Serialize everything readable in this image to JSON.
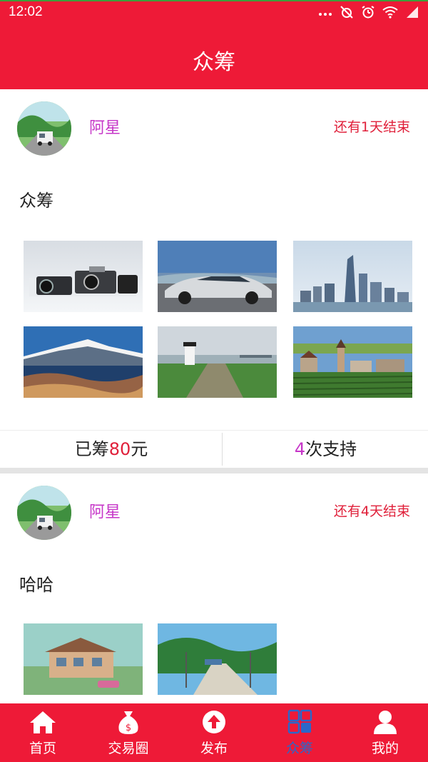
{
  "status_bar": {
    "time": "12:02",
    "icons": [
      "more-dots-icon",
      "alarm-off-icon",
      "alarm-clock-icon",
      "wifi-icon",
      "signal-icon"
    ]
  },
  "app_bar": {
    "title": "众筹"
  },
  "posts": [
    {
      "author": "阿星",
      "remaining": "还有1天结束",
      "content": "众筹",
      "images": [
        "cameras",
        "silver-car",
        "city-skyline",
        "snow-mountain-lake",
        "lighthouse-coast",
        "old-town-vineyard"
      ],
      "stats": {
        "raised_prefix": "已筹",
        "raised_amount": "80",
        "raised_unit": "元",
        "support_count": "4",
        "support_suffix": "次支持"
      }
    },
    {
      "author": "阿星",
      "remaining": "还有4天结束",
      "content": "哈哈",
      "images": [
        "anime-house",
        "anime-street"
      ]
    }
  ],
  "tab_bar": {
    "tabs": [
      {
        "label": "首页",
        "icon": "home-icon",
        "active": false
      },
      {
        "label": "交易圈",
        "icon": "money-bag-icon",
        "active": false
      },
      {
        "label": "发布",
        "icon": "upload-icon",
        "active": false
      },
      {
        "label": "众筹",
        "icon": "grid-icon",
        "active": true
      },
      {
        "label": "我的",
        "icon": "user-icon",
        "active": false
      }
    ]
  },
  "colors": {
    "primary": "#ee1a37",
    "author_name": "#c636c8",
    "remaining_text": "#e0203a",
    "active_tab": "#2b67c9"
  }
}
